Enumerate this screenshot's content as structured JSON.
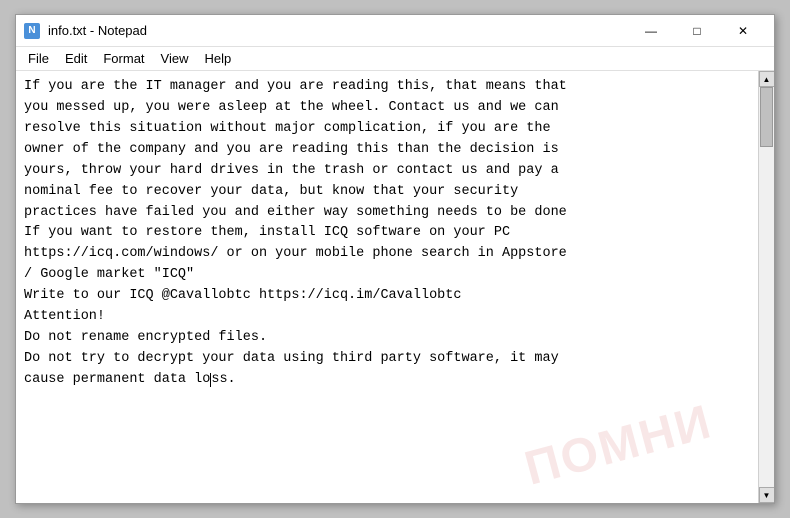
{
  "window": {
    "title": "info.txt - Notepad",
    "icon_label": "N"
  },
  "titlebar": {
    "minimize_label": "—",
    "maximize_label": "□",
    "close_label": "✕"
  },
  "menubar": {
    "items": [
      "File",
      "Edit",
      "Format",
      "View",
      "Help"
    ]
  },
  "content": {
    "text": "If you are the IT manager and you are reading this, that means that\nyou messed up, you were asleep at the wheel. Contact us and we can\nresolve this situation without major complication, if you are the\nowner of the company and you are reading this than the decision is\nyours, throw your hard drives in the trash or contact us and pay a\nnominal fee to recover your data, but know that your security\npractices have failed you and either way something needs to be done\nIf you want to restore them, install ICQ software on your PC\nhttps://icq.com/windows/ or on your mobile phone search in Appstore\n/ Google market \"ICQ\"\nWrite to our ICQ @Cavallobtc https://icq.im/Cavallobtc\nAttention!\nDo not rename encrypted files.\nDo not try to decrypt your data using third party software, it may\ncause permanent data lo|ss."
  },
  "watermark": {
    "text": "ПОМНИ"
  }
}
